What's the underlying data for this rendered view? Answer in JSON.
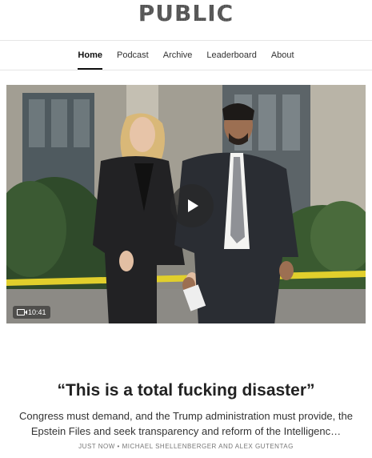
{
  "site": {
    "logo_text": "PUBLIC"
  },
  "nav": {
    "items": [
      {
        "label": "Home",
        "active": true
      },
      {
        "label": "Podcast",
        "active": false
      },
      {
        "label": "Archive",
        "active": false
      },
      {
        "label": "Leaderboard",
        "active": false
      },
      {
        "label": "About",
        "active": false
      }
    ]
  },
  "video": {
    "duration": "10:41",
    "play_icon": "play-icon",
    "camera_icon": "video-camera-icon"
  },
  "article": {
    "title": "“This is a total fucking disaster”",
    "subtitle": "Congress must demand, and the Trump administration must provide, the Epstein Files and seek transparency and reform of the Intelligenc…",
    "time": "JUST NOW",
    "separator": "•",
    "authors": "MICHAEL SHELLENBERGER AND ALEX GUTENTAG"
  },
  "colors": {
    "text": "#222222",
    "muted": "#777777",
    "divider": "#e6e6e6"
  }
}
